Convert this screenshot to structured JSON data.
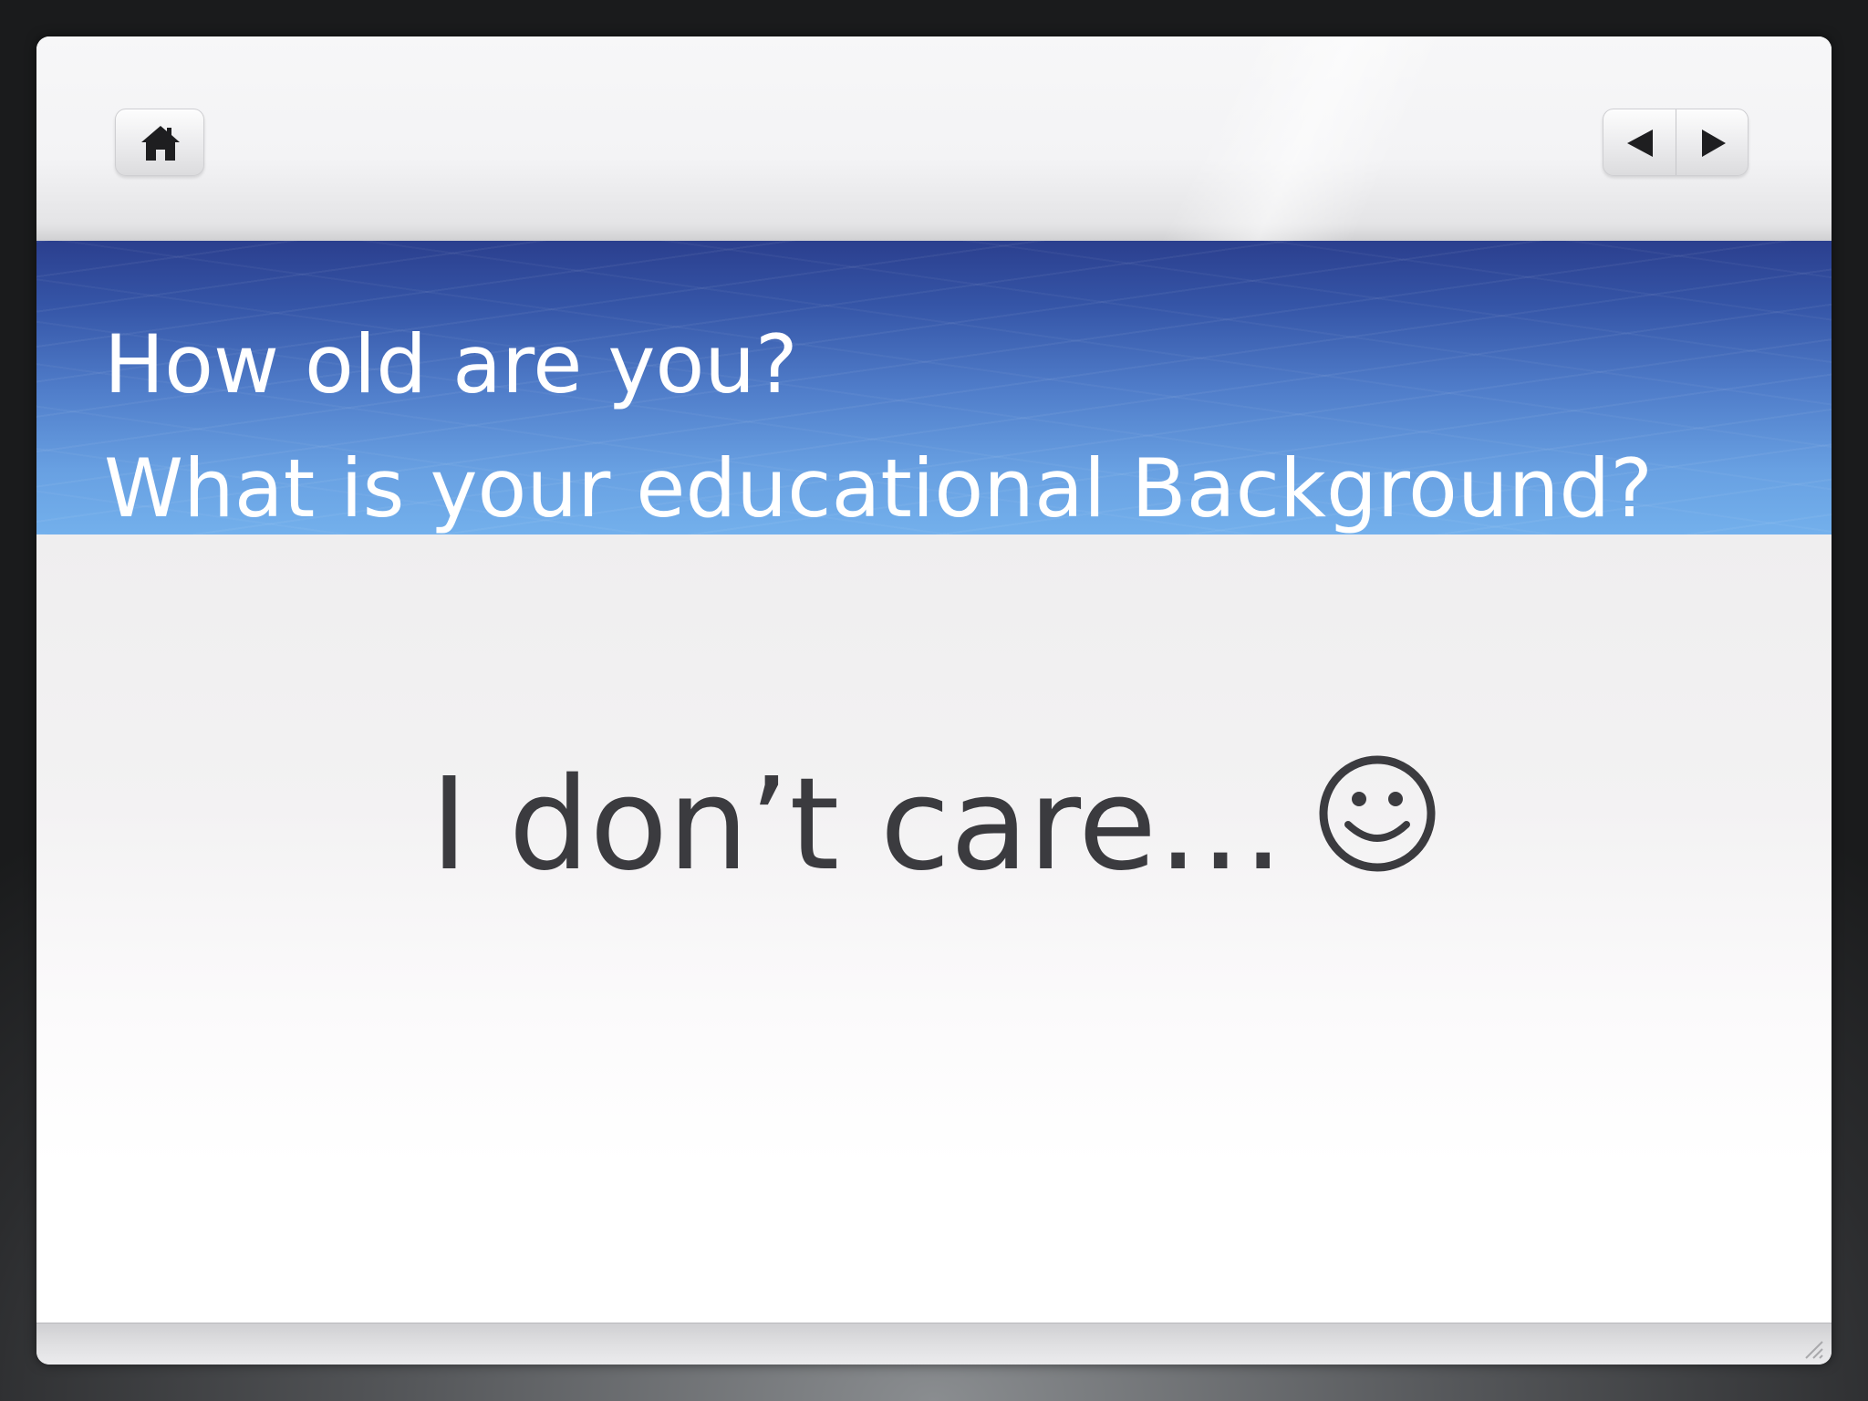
{
  "toolbar": {
    "home_icon": "home-icon",
    "prev_icon": "triangle-left-icon",
    "next_icon": "triangle-right-icon"
  },
  "banner": {
    "line1": "How old are you?",
    "line2": "What is your educational Background?"
  },
  "body": {
    "text": "I don’t care…",
    "emoji_icon": "smiley-face-icon"
  },
  "colors": {
    "banner_top": "#2b3f8e",
    "banner_bottom": "#73b0ec",
    "body_text": "#3b3b3f",
    "title_text": "#ffffff"
  }
}
